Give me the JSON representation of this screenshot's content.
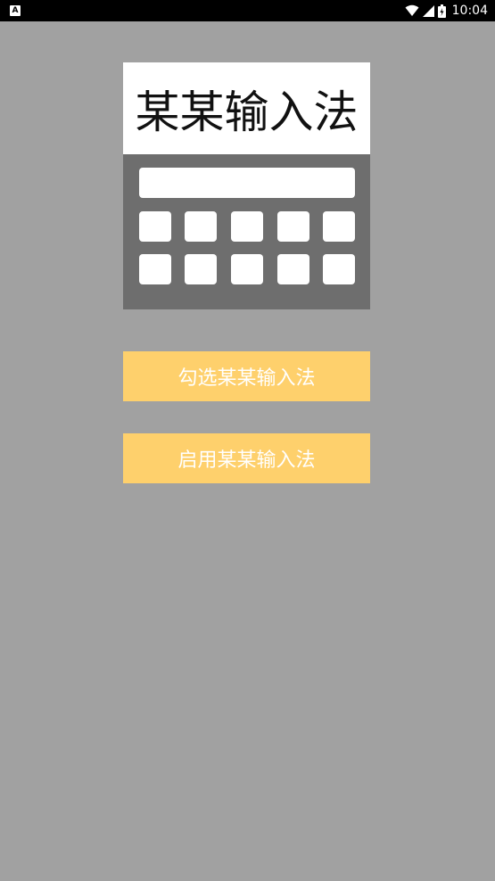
{
  "status_bar": {
    "left_icon": "A",
    "left_icon_name": "notification-a-icon",
    "icons": [
      "wifi-icon",
      "signal-icon",
      "battery-icon"
    ],
    "time": "10:04"
  },
  "logo": {
    "title": "某某输入法"
  },
  "buttons": {
    "check_label": "勾选某某输入法",
    "enable_label": "启用某某输入法"
  },
  "colors": {
    "background": "#a1a1a1",
    "button": "#fed06c",
    "keyboard": "#6e6e6e",
    "status_bar": "#000000"
  }
}
